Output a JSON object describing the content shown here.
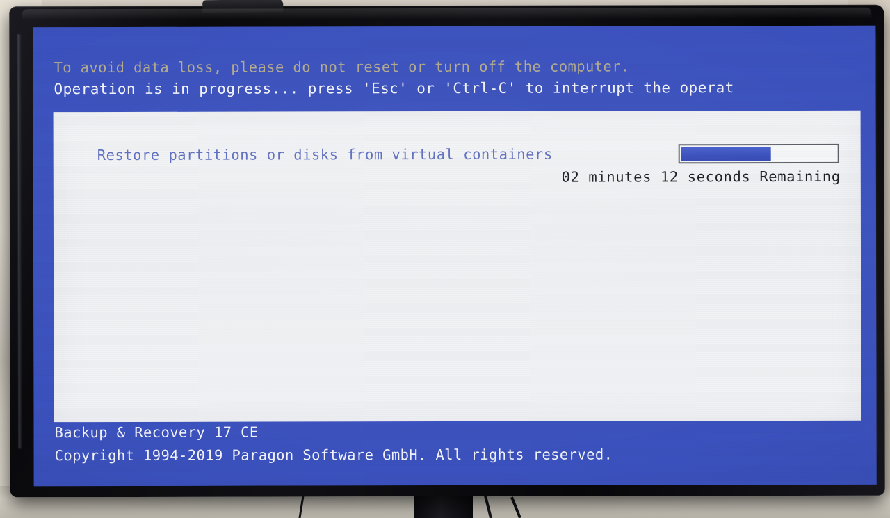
{
  "app": {
    "product_name": "Backup & Recovery 17 CE",
    "copyright": "Copyright 1994-2019 Paragon Software GmbH. All rights reserved."
  },
  "header": {
    "warning_line": "To avoid data loss, please do not reset or turn off the computer.",
    "operation_line": "Operation is in progress... press 'Esc' or 'Ctrl-C' to interrupt the operat"
  },
  "task": {
    "label": "Restore partitions or disks from virtual containers",
    "eta_text": "02 minutes 12 seconds Remaining",
    "eta_minutes": "02",
    "eta_seconds": "12"
  },
  "progress": {
    "percent": 58,
    "percent_label": "58%"
  },
  "colors": {
    "screen_blue": "#3b51bd",
    "panel_white": "#f1f2f5",
    "warning_text": "#b3aa8e",
    "primary_text": "#f2f3f8",
    "task_text": "#5f6fc0",
    "eta_text": "#1c1c24",
    "progress_fill": "#3c52c0",
    "progress_border": "#5d6068",
    "bezel_black": "#0d0d11",
    "wall_beige": "#ded8cc"
  }
}
